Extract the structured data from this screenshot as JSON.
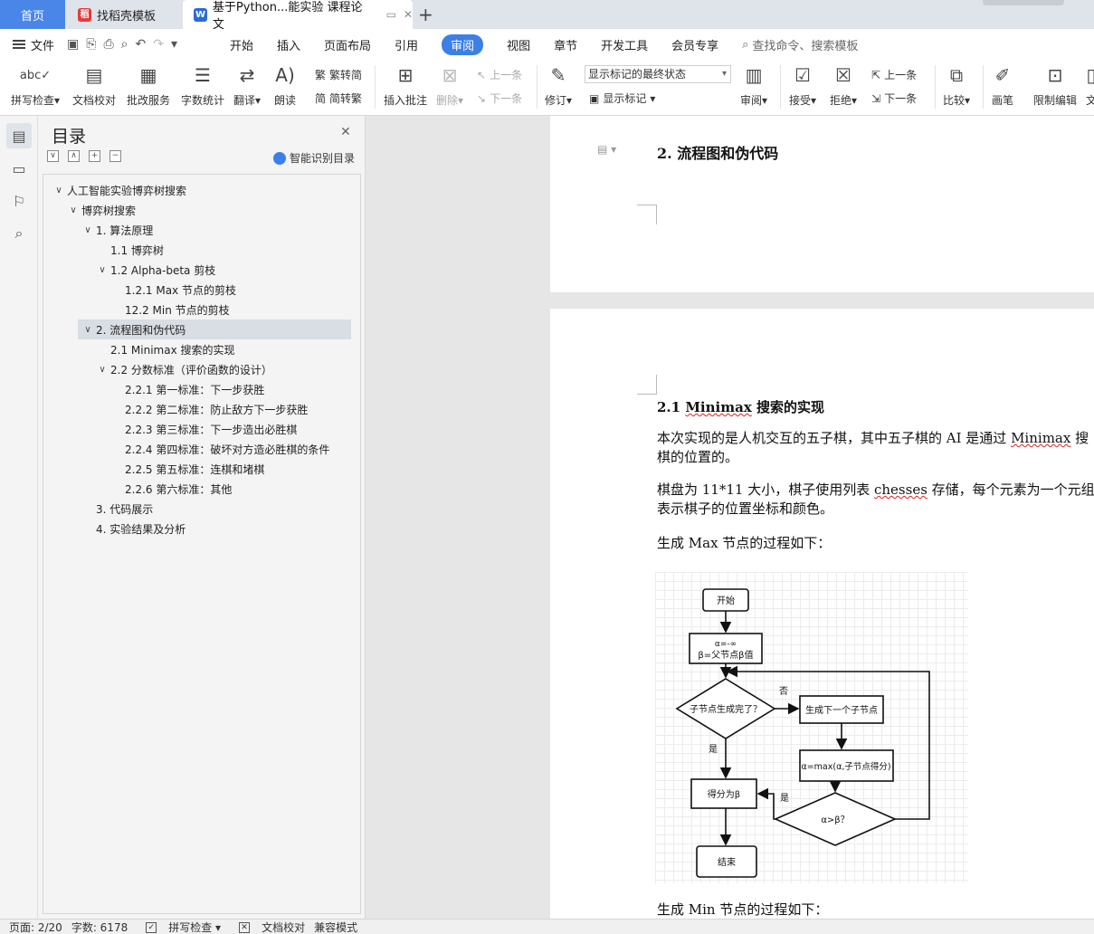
{
  "tabs": {
    "home": "首页",
    "template": "找稻壳模板",
    "document": "基于Python...能实验 课程论文"
  },
  "menu": {
    "file": "文件",
    "items": [
      "开始",
      "插入",
      "页面布局",
      "引用"
    ],
    "active": "审阅",
    "items2": [
      "视图",
      "章节",
      "开发工具",
      "会员专享"
    ],
    "search_placeholder": "查找命令、搜索模板"
  },
  "ribbon": {
    "spellcheck": "拼写检查",
    "doc_proof": "文档校对",
    "batch_service": "批改服务",
    "word_count": "字数统计",
    "translate": "翻译",
    "read_aloud": "朗读",
    "trad_to_simp": "繁转简",
    "simp_to_trad": "简转繁",
    "insert_comment": "插入批注",
    "delete": "删除",
    "prev_comment": "上一条",
    "next_comment": "下一条",
    "track_changes": "修订",
    "markup_state": "显示标记的最终状态",
    "show_markup": "显示标记",
    "review": "审阅",
    "accept": "接受",
    "reject": "拒绝",
    "prev_change": "上一条",
    "next_change": "下一条",
    "compare": "比较",
    "pen": "画笔",
    "restrict_edit": "限制编辑",
    "doc_cut": "文"
  },
  "toc": {
    "title": "目录",
    "smart_detect": "智能识别目录",
    "items": [
      {
        "label": "人工智能实验博弈树搜索",
        "caret": "∨"
      },
      {
        "label": "博弈树搜索",
        "caret": "∨"
      },
      {
        "label": "1.  算法原理",
        "caret": "∨"
      },
      {
        "label": "1.1  博弈树",
        "caret": ""
      },
      {
        "label": "1.2 Alpha-beta 剪枝",
        "caret": "∨"
      },
      {
        "label": "1.2.1 Max 节点的剪枝",
        "caret": ""
      },
      {
        "label": "12.2 Min 节点的剪枝",
        "caret": ""
      },
      {
        "label": "2.  流程图和伪代码",
        "caret": "∨"
      },
      {
        "label": "2.1 Minimax 搜索的实现",
        "caret": ""
      },
      {
        "label": "2.2  分数标准（评价函数的设计）",
        "caret": "∨"
      },
      {
        "label": "2.2.1  第一标准：下一步获胜",
        "caret": ""
      },
      {
        "label": "2.2.2  第二标准：防止敌方下一步获胜",
        "caret": ""
      },
      {
        "label": "2.2.3  第三标准：下一步造出必胜棋",
        "caret": ""
      },
      {
        "label": "2.2.4  第四标准：破坏对方造必胜棋的条件",
        "caret": ""
      },
      {
        "label": "2.2.5  第五标准：连棋和堵棋",
        "caret": ""
      },
      {
        "label": "2.2.6  第六标准：其他",
        "caret": ""
      },
      {
        "label": "3.  代码展示",
        "caret": ""
      },
      {
        "label": "4.  实验结果及分析",
        "caret": ""
      }
    ]
  },
  "document": {
    "heading_2": "2.  流程图和伪代码",
    "heading_21_num": "2.1 ",
    "heading_21_word": "Minimax",
    "heading_21_rest": " 搜索的实现",
    "p1_a": "本次实现的是人机交互的五子棋，其中五子棋的 AI 是通过 ",
    "p1_b": "Minimax",
    "p1_c": " 搜",
    "p1_line2": "棋的位置的。",
    "p2_a": "棋盘为 11*11 大小，棋子使用列表 ",
    "p2_b": "chesses",
    "p2_c": " 存储，每个元素为一个元组(x",
    "p2_line2": "表示棋子的位置坐标和颜色。",
    "p3": "生成 Max 节点的过程如下：",
    "p4": "生成 Min 节点的过程如下："
  },
  "flowchart": {
    "start": "开始",
    "init_a": "α=-∞",
    "init_b": "β=父节点β值",
    "decision": "子节点生成完了？",
    "no": "否",
    "gen_child": "生成下一个子节点",
    "update": "α=max(α,子节点得分)",
    "compare": "α>β？",
    "yes_right": "是",
    "yes_down": "是",
    "score": "得分为β",
    "end": "结束"
  },
  "status": {
    "page": "页面: 2/20",
    "words": "字数: 6178",
    "spell": "拼写检查",
    "proof": "文档校对",
    "compat": "兼容模式"
  }
}
